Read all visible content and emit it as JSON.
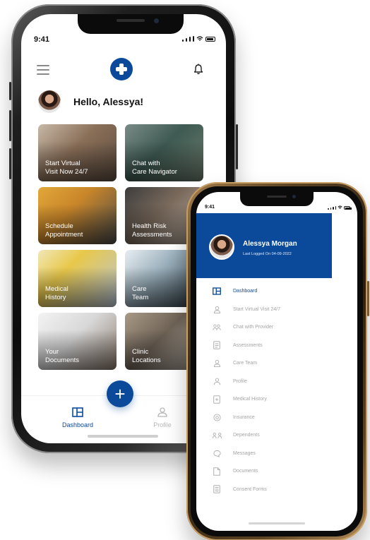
{
  "phone1": {
    "status_time": "9:41",
    "greeting": "Hello, Alessya!",
    "tiles": [
      {
        "label": "Start Virtual\nVisit Now 24/7"
      },
      {
        "label": "Chat with\nCare Navigator"
      },
      {
        "label": "Schedule\nAppointment"
      },
      {
        "label": "Health Risk\nAssessments"
      },
      {
        "label": "Medical\nHistory"
      },
      {
        "label": "Care\nTeam"
      },
      {
        "label": "Your\nDocuments"
      },
      {
        "label": "Clinic\nLocations"
      }
    ],
    "fab_label": "+",
    "tabs": [
      {
        "label": "Dashboard",
        "icon": "dashboard-icon",
        "active": true
      },
      {
        "label": "Profile",
        "icon": "profile-icon",
        "active": false
      }
    ]
  },
  "phone2": {
    "status_time": "9:41",
    "user_name": "Alessya Morgan",
    "last_logged": "Last Logged On 04-09-2022",
    "menu": [
      {
        "label": "Dashboard",
        "icon": "dashboard-icon",
        "active": true
      },
      {
        "label": "Start Virtual Visit 24/7",
        "icon": "virtual-visit-icon",
        "active": false
      },
      {
        "label": "Chat with Provider",
        "icon": "chat-provider-icon",
        "active": false
      },
      {
        "label": "Assessments",
        "icon": "assessments-icon",
        "active": false
      },
      {
        "label": "Care Team",
        "icon": "care-team-icon",
        "active": false
      },
      {
        "label": "Profile",
        "icon": "profile-icon",
        "active": false
      },
      {
        "label": "Medical History",
        "icon": "medical-history-icon",
        "active": false
      },
      {
        "label": "Insurance",
        "icon": "insurance-icon",
        "active": false
      },
      {
        "label": "Dependents",
        "icon": "dependents-icon",
        "active": false
      },
      {
        "label": "Messages",
        "icon": "messages-icon",
        "active": false
      },
      {
        "label": "Documents",
        "icon": "documents-icon",
        "active": false
      },
      {
        "label": "Consent Forms",
        "icon": "consent-forms-icon",
        "active": false
      }
    ]
  },
  "colors": {
    "brand": "#0b4a9b",
    "inactive": "#a4a4a4"
  }
}
